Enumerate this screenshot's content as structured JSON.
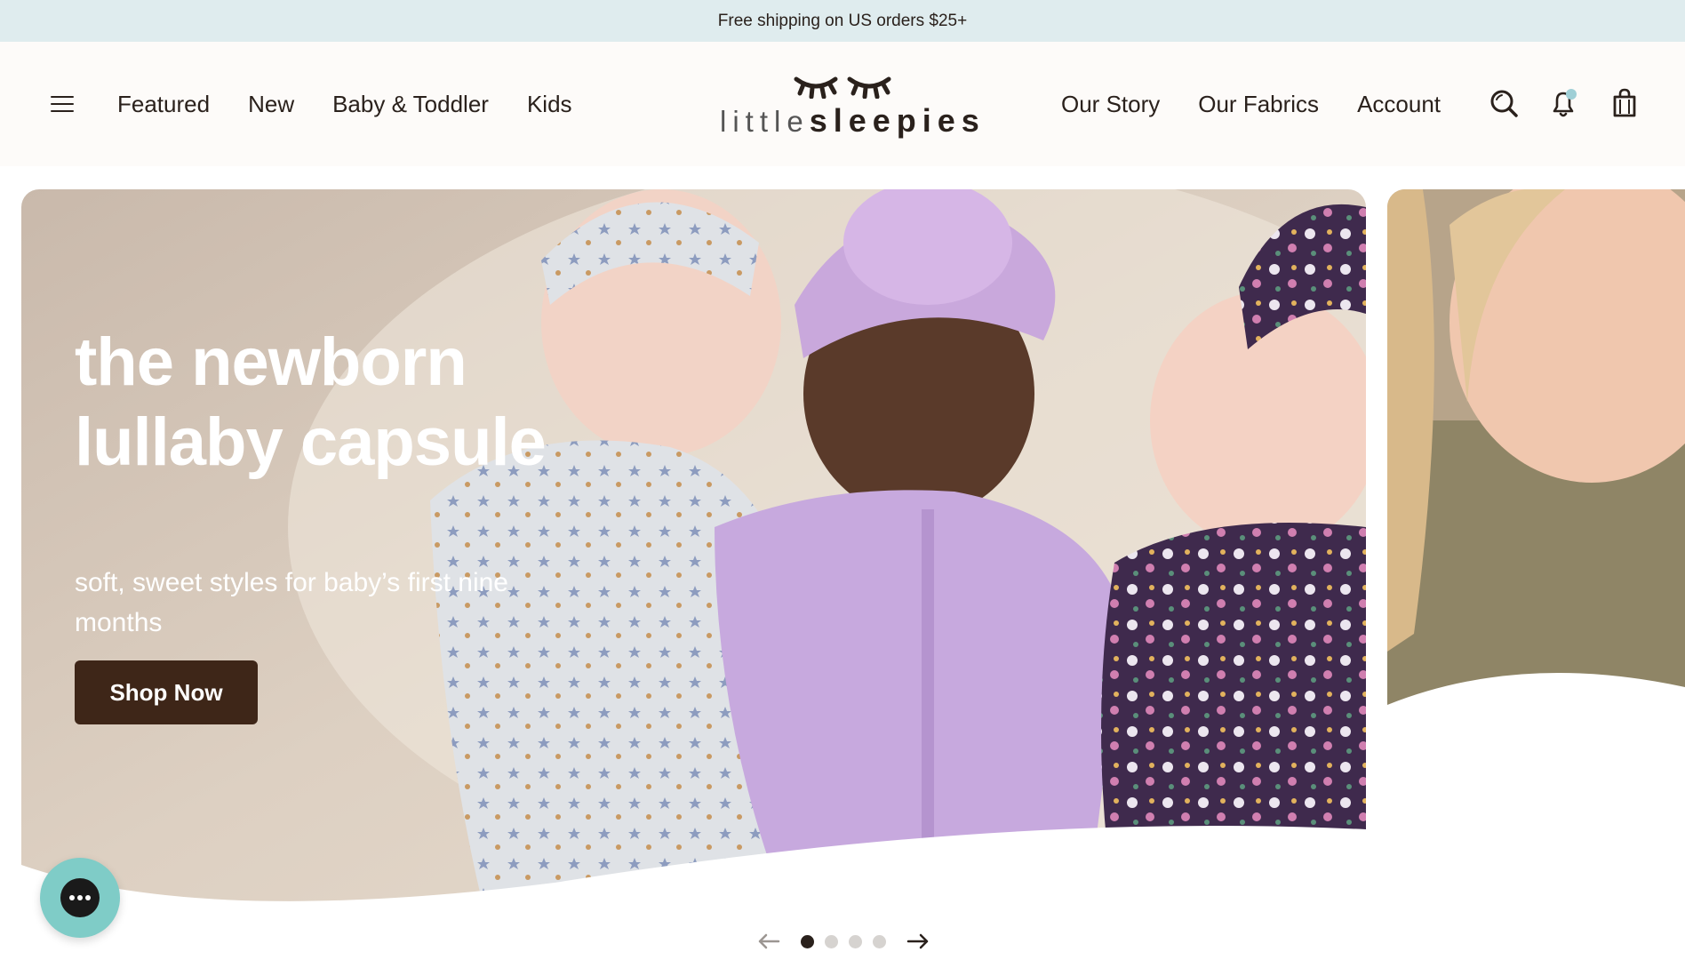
{
  "announcement": {
    "text": "Free shipping on US orders $25+"
  },
  "header": {
    "nav_left": [
      {
        "label": "Featured"
      },
      {
        "label": "New"
      },
      {
        "label": "Baby & Toddler"
      },
      {
        "label": "Kids"
      }
    ],
    "logo": {
      "text_light": "little",
      "text_bold": "sleepies"
    },
    "nav_right": [
      {
        "label": "Our Story"
      },
      {
        "label": "Our Fabrics"
      },
      {
        "label": "Account"
      }
    ],
    "icons": [
      "menu-icon",
      "search-icon",
      "bell-icon",
      "shopping-bag-icon"
    ]
  },
  "hero": {
    "title": "the newborn lullaby capsule",
    "subtitle": "soft, sweet styles for baby’s first nine months",
    "cta_label": "Shop Now"
  },
  "carousel": {
    "slide_count": 4,
    "active_index": 0
  },
  "colors": {
    "announcement_bg": "#dfecee",
    "header_bg": "#fdfbf9",
    "cta_bg": "#3e2618",
    "chat_bg": "#7fccc7",
    "notification_dot": "#9fcfd6"
  }
}
